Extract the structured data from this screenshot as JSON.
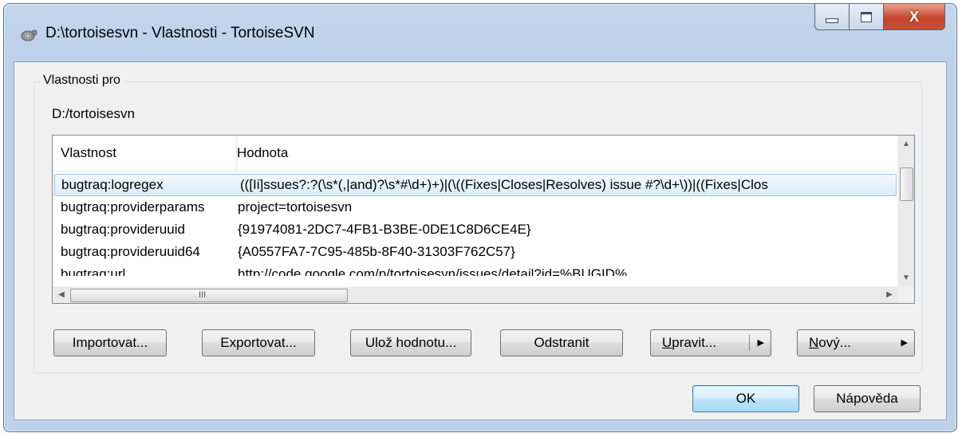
{
  "window": {
    "title": "D:\\tortoisesvn - Vlastnosti - TortoiseSVN",
    "minimize_glyph": "—",
    "maximize_glyph": "□",
    "close_glyph": "X"
  },
  "group": {
    "legend": "Vlastnosti pro",
    "path": "D:/tortoisesvn"
  },
  "list": {
    "columns": [
      "Vlastnost",
      "Hodnota"
    ],
    "rows": [
      {
        "name": "bugtraq:logregex",
        "value": "(([Ii]ssues?:?(\\s*(,|and)?\\s*#\\d+)+)|(\\((Fixes|Closes|Resolves) issue #?\\d+\\))|((Fixes|Clos"
      },
      {
        "name": "bugtraq:providerparams",
        "value": "project=tortoisesvn"
      },
      {
        "name": "bugtraq:provideruuid",
        "value": "{91974081-2DC7-4FB1-B3BE-0DE1C8D6CE4E}"
      },
      {
        "name": "bugtraq:provideruuid64",
        "value": "{A0557FA7-7C95-485b-8F40-31303F762C57}"
      },
      {
        "name": "bugtraq:url",
        "value": "http://code.google.com/p/tortoisesvn/issues/detail?id=%BUGID%"
      }
    ],
    "selected_index": 0,
    "hscroll_grip": "III"
  },
  "buttons": {
    "import": "Importovat...",
    "export": "Exportovat...",
    "save_value": "Ulož hodnotu...",
    "remove": "Odstranit",
    "edit_mnemonic": "U",
    "edit_rest": "pravit...",
    "new_mnemonic": "N",
    "new_rest": "ový...",
    "ok": "OK",
    "help": "Nápověda"
  }
}
